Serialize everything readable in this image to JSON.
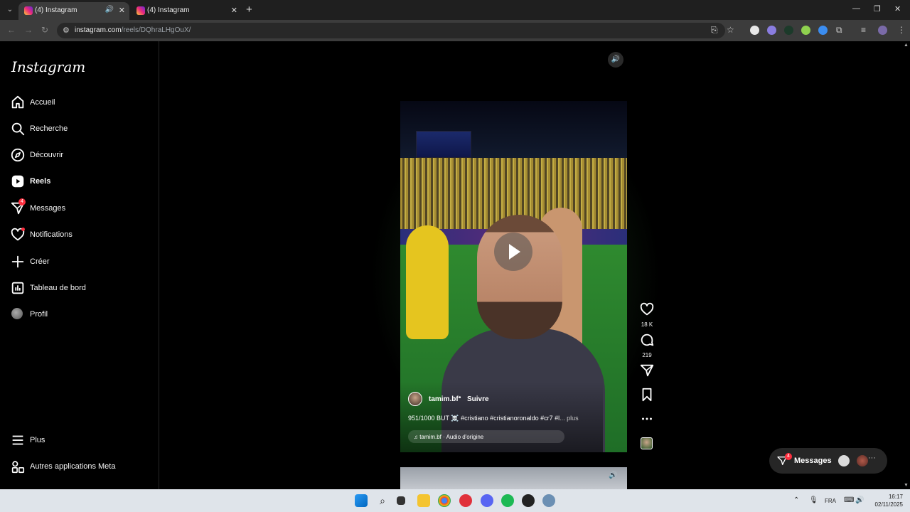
{
  "browser": {
    "tabs": [
      {
        "title": "(4) Instagram",
        "active": true
      },
      {
        "title": "(4) Instagram",
        "active": false
      }
    ],
    "url_host": "instagram.com",
    "url_path": "/reels/DQhraLHgOuX/"
  },
  "sidebar": {
    "logo": "Instagram",
    "items": [
      {
        "label": "Accueil",
        "icon": "home-icon"
      },
      {
        "label": "Recherche",
        "icon": "search-icon"
      },
      {
        "label": "Découvrir",
        "icon": "compass-icon"
      },
      {
        "label": "Reels",
        "icon": "reels-icon"
      },
      {
        "label": "Messages",
        "icon": "messenger-icon",
        "badge": "4"
      },
      {
        "label": "Notifications",
        "icon": "heart-icon"
      },
      {
        "label": "Créer",
        "icon": "plus-icon"
      },
      {
        "label": "Tableau de bord",
        "icon": "dashboard-icon"
      },
      {
        "label": "Profil",
        "icon": "avatar"
      }
    ],
    "bottom": [
      {
        "label": "Plus",
        "icon": "menu-icon"
      },
      {
        "label": "Autres applications Meta",
        "icon": "meta-apps-icon"
      }
    ]
  },
  "reel": {
    "username": "tamim.bf",
    "separator": "•",
    "follow": "Suivre",
    "caption": "951/1000 BUT ☠️ #cristiano #cristianoronaldo #cr7 #l",
    "caption_more": "... plus",
    "audio": "♫ tamim.bf · Audio d'origine",
    "likes": "18 K",
    "comments": "219"
  },
  "messages_pill": {
    "label": "Messages",
    "badge": "4"
  },
  "taskbar": {
    "lang": "FRA",
    "time": "16:17",
    "date": "02/11/2025"
  },
  "colors": {
    "accent_red": "#ff3040",
    "background": "#000000"
  }
}
